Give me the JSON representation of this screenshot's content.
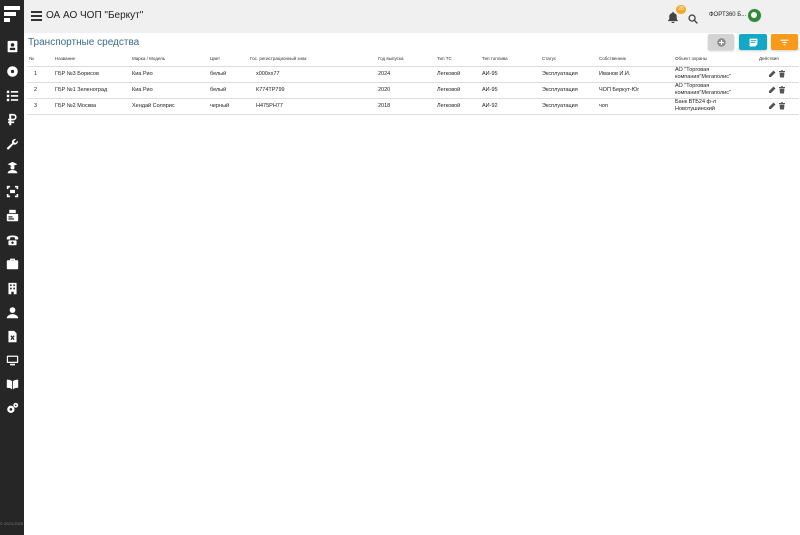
{
  "topbar": {
    "title": "ОА АО ЧОП \"Беркут\"",
    "notification_count": "28",
    "user_name": "ФОРТ360 Б..."
  },
  "sidebar": {
    "items": [
      {
        "icon": "contact-card-icon"
      },
      {
        "icon": "dashboard-icon"
      },
      {
        "icon": "checklist-icon"
      },
      {
        "icon": "ruble-icon"
      },
      {
        "icon": "wrench-icon"
      },
      {
        "icon": "person-badge-icon"
      },
      {
        "icon": "scanner-icon"
      },
      {
        "icon": "id-card-icon"
      },
      {
        "icon": "phone-icon"
      },
      {
        "icon": "briefcase-icon"
      },
      {
        "icon": "building-icon"
      },
      {
        "icon": "user-icon"
      },
      {
        "icon": "document-icon"
      },
      {
        "icon": "monitor-icon"
      },
      {
        "icon": "book-icon"
      },
      {
        "icon": "settings-icon"
      }
    ],
    "copyright": "© 2024-2026 ver 1.0"
  },
  "page": {
    "title": "Транспортные средства"
  },
  "toolbar": {
    "add_icon": "plus-circle-icon",
    "note_icon": "note-icon",
    "filter_icon": "filter-icon",
    "colors": {
      "add": "#d4d4d4",
      "note": "#13a8c8",
      "filter": "#f79a1a"
    }
  },
  "table": {
    "headers": [
      "№",
      "Название",
      "Марка / Модель",
      "Цвет",
      "Гос. регистрационный знак",
      "Год выпуска",
      "Тип ТС",
      "Тип топлива",
      "Статус",
      "Собственник",
      "Объект охраны",
      "Действия"
    ],
    "rows": [
      [
        "1",
        "ГБР №3 Борисов",
        "Киа Рио",
        "белый",
        "х000хх77",
        "2024",
        "Легковой",
        "АИ-95",
        "Эксплуатация",
        "Иванов И.И.",
        "АО \"Торговая компания\"Мегаполис\""
      ],
      [
        "2",
        "ГБР №1 Зеленоград",
        "Киа Рио",
        "белый",
        "К774ТР799",
        "2020",
        "Легковой",
        "АИ-95",
        "Эксплуатация",
        "ЧОП Беркут-Юг",
        "АО \"Торговая компания\"Мегаполис\""
      ],
      [
        "3",
        "ГБР №2 Москва",
        "Хендай Солярис",
        "черный",
        "Н475РН77",
        "2018",
        "Легковой",
        "АИ-92",
        "Эксплуатация",
        "чоп",
        "Банк ВТБ24 ф-л Новотушинский"
      ]
    ]
  }
}
